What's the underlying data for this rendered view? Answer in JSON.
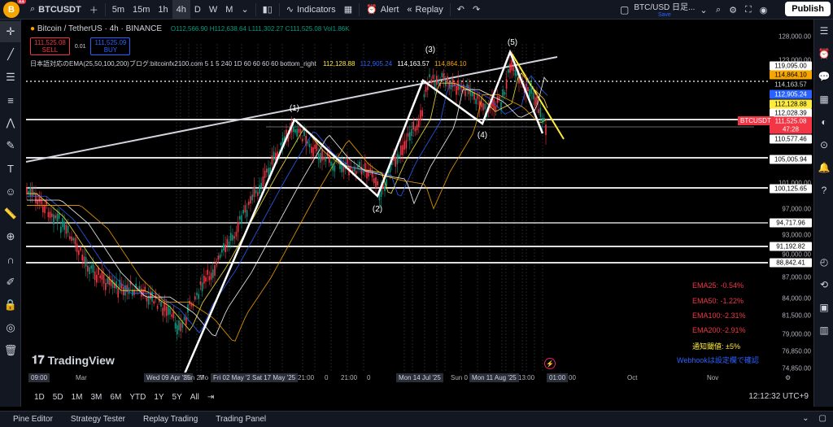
{
  "topbar": {
    "avatar_letter": "B",
    "notif_count": "11",
    "symbol": "BTCUSDT",
    "intervals": [
      "5m",
      "15m",
      "1h",
      "4h",
      "D",
      "W",
      "M"
    ],
    "active_interval": "4h",
    "indicators_label": "Indicators",
    "alert_label": "Alert",
    "replay_label": "Replay",
    "layout_title": "BTC/USD 日足...",
    "layout_save": "Save",
    "publish_label": "Publish"
  },
  "legend": {
    "title": "Bitcoin / TetherUS · 4h · BINANCE",
    "ohlc": "O112,566.90 H112,638.64 L111,302.27 C111,525.08 Vol1.86K",
    "sell_price": "111,525.08",
    "sell_label": "SELL",
    "spread": "0.01",
    "buy_price": "111,525.09",
    "buy_label": "BUY",
    "ema_text": "日本語対応のEMA(25,50,100,200)ブログ:bitcoinfx2100.com 5 1 5 240 1D 60 60 60 60 bottom_right",
    "ema_vals": [
      {
        "v": "112,128.88",
        "c": "#ffeb3b"
      },
      {
        "v": "112,905.24",
        "c": "#2962ff"
      },
      {
        "v": "114,163.57",
        "c": "#ffffff"
      },
      {
        "v": "114,864.10",
        "c": "#f7a600"
      }
    ]
  },
  "waves": [
    "(1)",
    "(2)",
    "(3)",
    "(4)",
    "(5)"
  ],
  "price_labels": [
    "128,000.00",
    "123,000.00",
    "101,000.00",
    "97,000.00",
    "93,000.00",
    "90,000.00",
    "87,000.00",
    "84,000.00",
    "81,500.00",
    "79,000.00",
    "76,850.00",
    "74,850.00"
  ],
  "price_tags": [
    {
      "v": "119,095.00",
      "bg": "#ffffff",
      "fg": "#000000"
    },
    {
      "v": "114,864.10",
      "bg": "#f7a600",
      "fg": "#000000"
    },
    {
      "v": "114,163.57",
      "bg": "#000000",
      "fg": "#d1d4dc"
    },
    {
      "v": "112,905.24",
      "bg": "#2962ff",
      "fg": "#ffffff"
    },
    {
      "v": "112,128.88",
      "bg": "#ffeb3b",
      "fg": "#000000"
    },
    {
      "v": "112,028.39",
      "bg": "#ffffff",
      "fg": "#000000"
    },
    {
      "v": "111,525.08",
      "bg": "#f23645",
      "fg": "#ffffff"
    },
    {
      "v": "47:28",
      "bg": "#f23645",
      "fg": "#ffffff"
    },
    {
      "v": "110,577.46",
      "bg": "#ffffff",
      "fg": "#000000"
    },
    {
      "v": "105,005.94",
      "bg": "#ffffff",
      "fg": "#000000"
    },
    {
      "v": "100,125.65",
      "bg": "#ffffff",
      "fg": "#000000"
    },
    {
      "v": "94,717.96",
      "bg": "#ffffff",
      "fg": "#000000"
    },
    {
      "v": "91,192.82",
      "bg": "#ffffff",
      "fg": "#000000"
    },
    {
      "v": "88,842.41",
      "bg": "#ffffff",
      "fg": "#000000"
    }
  ],
  "symbol_tag": "BTCUSDT",
  "time_labels": [
    "09:00",
    "Mar",
    "Wed 09 Apr '25",
    "Sun 27",
    "Mo",
    "Fri 02 May '25",
    "Sat 17 May '25",
    "21:00",
    "0",
    "21:00",
    "0",
    "Mon 14 Jul '25",
    "Sun 0",
    "Mon 11 Aug '25",
    "13:00",
    "01:00",
    "00",
    "Oct",
    "Nov"
  ],
  "ema_pct": [
    {
      "label": "EMA25: -0.54%",
      "cls": ""
    },
    {
      "label": "EMA50: -1.22%",
      "cls": ""
    },
    {
      "label": "EMA100:-2.31%",
      "cls": ""
    },
    {
      "label": "EMA200:-2.91%",
      "cls": ""
    },
    {
      "label": "通知閾値: ±5%",
      "cls": "y"
    },
    {
      "label": "Webhookは設定欄で確認",
      "cls": "b"
    }
  ],
  "logo_text": "TradingView",
  "bottom": {
    "ranges": [
      "1D",
      "5D",
      "1M",
      "3M",
      "6M",
      "YTD",
      "1Y",
      "5Y",
      "All"
    ],
    "clock": "12:12:32 UTC+9"
  },
  "panels": [
    "Pine Editor",
    "Strategy Tester",
    "Replay Trading",
    "Trading Panel"
  ],
  "colors": {
    "up": "#089981",
    "down": "#f23645",
    "ema25": "#ffeb3b",
    "ema50": "#2962ff",
    "ema100": "#ffffff",
    "ema200": "#f7a600",
    "bg": "#000000"
  }
}
